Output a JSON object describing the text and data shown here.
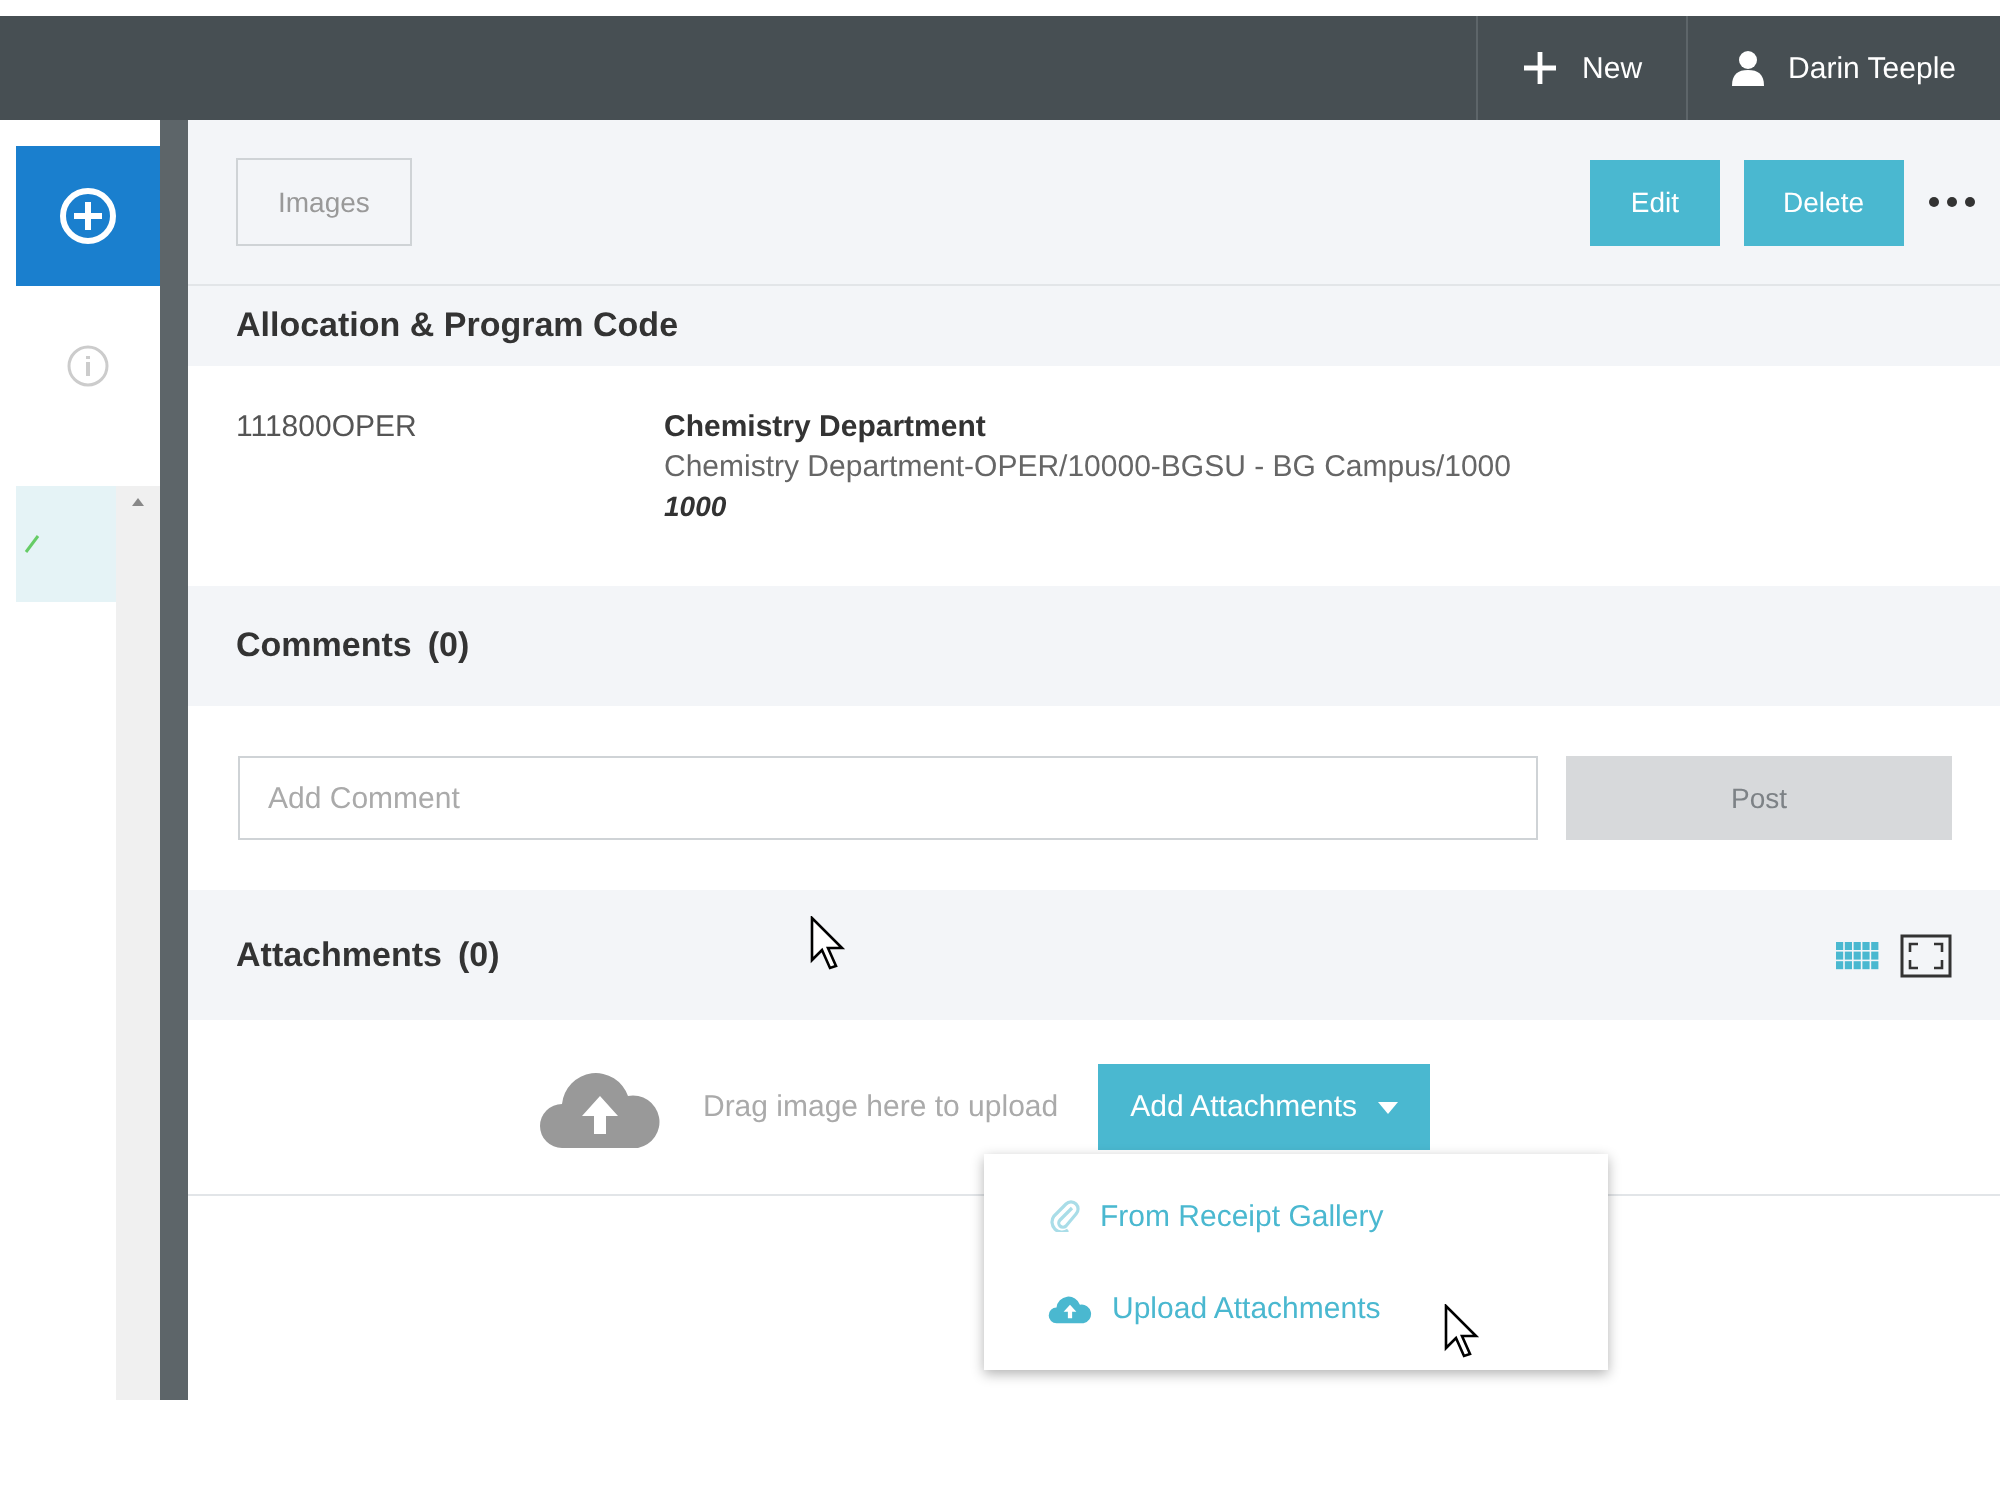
{
  "topbar": {
    "new_label": "New",
    "user_name": "Darin Teeple"
  },
  "toolbar": {
    "images_label": "Images",
    "buttons": [
      "Edit",
      "Delete"
    ]
  },
  "allocation": {
    "title": "Allocation & Program Code",
    "code": "111800OPER",
    "department": "Chemistry Department",
    "path": "Chemistry Department-OPER/10000-BGSU - BG Campus/1000",
    "amount": "1000"
  },
  "comments": {
    "title": "Comments",
    "count": "(0)",
    "placeholder": "Add Comment",
    "post": "Post",
    "post_disabled": true
  },
  "attachments": {
    "title": "Attachments",
    "count": "(0)",
    "drop_hint": "Drag image here to upload",
    "add_button": "Add Attachments",
    "menu_open": true,
    "menu": [
      {
        "label": "From Receipt Gallery",
        "kind": "gallery"
      },
      {
        "label": "Upload Attachments",
        "kind": "upload"
      }
    ]
  }
}
